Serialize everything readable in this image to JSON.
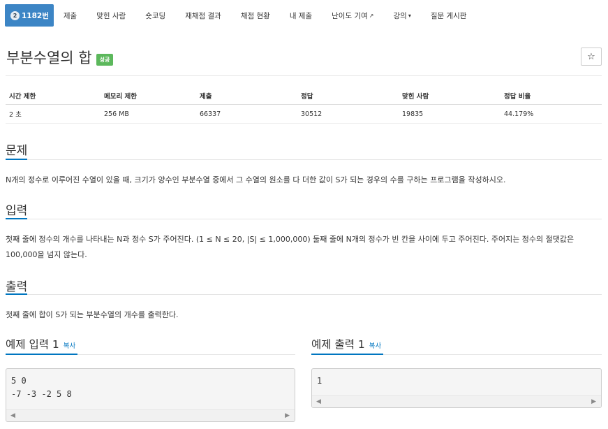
{
  "tabs": [
    {
      "label": "1182번",
      "tier": "2"
    },
    {
      "label": "제출"
    },
    {
      "label": "맞힌 사람"
    },
    {
      "label": "숏코딩"
    },
    {
      "label": "재채점 결과"
    },
    {
      "label": "채점 현황"
    },
    {
      "label": "내 제출"
    },
    {
      "label": "난이도 기여",
      "icon": "external-link-icon"
    },
    {
      "label": "강의",
      "icon": "caret-down-icon"
    },
    {
      "label": "질문 게시판"
    }
  ],
  "problem": {
    "title": "부분수열의 합",
    "badge": "성공",
    "star": "☆"
  },
  "info": {
    "headers": [
      "시간 제한",
      "메모리 제한",
      "제출",
      "정답",
      "맞힌 사람",
      "정답 비율"
    ],
    "values": [
      "2 초",
      "256 MB",
      "66337",
      "30512",
      "19835",
      "44.179%"
    ]
  },
  "sections": {
    "problem_title": "문제",
    "problem_text": "N개의 정수로 이루어진 수열이 있을 때, 크기가 양수인 부분수열 중에서 그 수열의 원소를 다 더한 값이 S가 되는 경우의 수를 구하는 프로그램을 작성하시오.",
    "input_title": "입력",
    "input_text": "첫째 줄에 정수의 개수를 나타내는 N과 정수 S가 주어진다. (1 ≤ N ≤ 20, |S| ≤ 1,000,000) 둘째 줄에 N개의 정수가 빈 칸을 사이에 두고 주어진다. 주어지는 정수의 절댓값은 100,000을 넘지 않는다.",
    "output_title": "출력",
    "output_text": "첫째 줄에 합이 S가 되는 부분수열의 개수를 출력한다."
  },
  "examples": {
    "input_title": "예제 입력 1",
    "output_title": "예제 출력 1",
    "copy_label": "복사",
    "input_text": "5 0\n-7 -3 -2 5 8",
    "output_text": "1"
  }
}
